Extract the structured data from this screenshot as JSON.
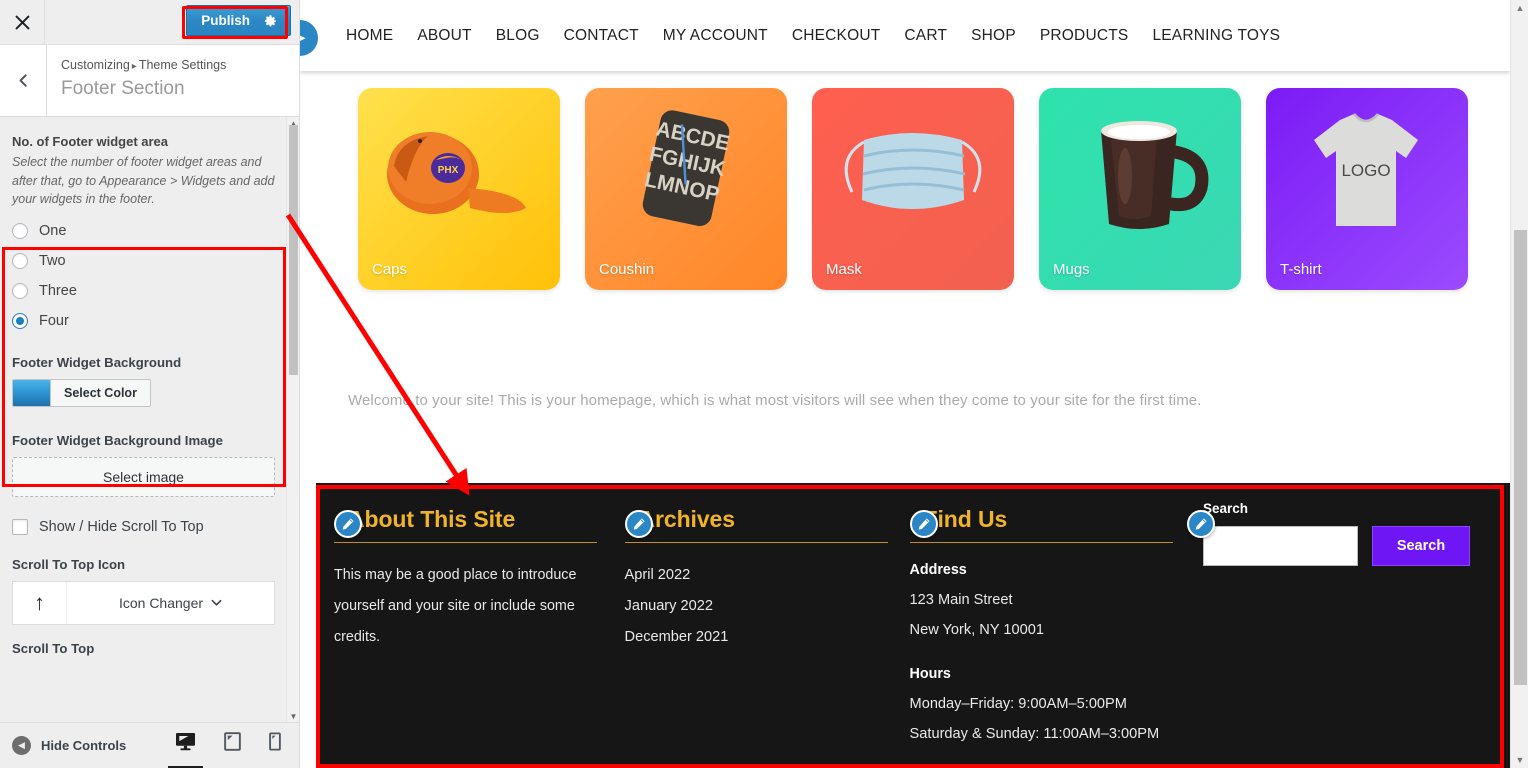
{
  "customizer": {
    "close_icon": "close-icon",
    "publish_label": "Publish",
    "gear_icon": "gear-icon",
    "back_icon": "chevron-left-icon",
    "breadcrumb_root": "Customizing",
    "breadcrumb_sep": "▸",
    "breadcrumb_parent": "Theme Settings",
    "section_title": "Footer Section",
    "controls": {
      "footer_widget_area": {
        "title": "No. of Footer widget area",
        "description": "Select the number of footer widget areas and after that, go to Appearance > Widgets and add your widgets in the footer.",
        "options": [
          {
            "label": "One",
            "checked": false
          },
          {
            "label": "Two",
            "checked": false
          },
          {
            "label": "Three",
            "checked": false
          },
          {
            "label": "Four",
            "checked": true
          }
        ],
        "selected": "Four"
      },
      "footer_widget_background": {
        "title": "Footer Widget Background",
        "button_label": "Select Color",
        "swatch_color": "#2f96d6"
      },
      "footer_widget_background_image": {
        "title": "Footer Widget Background Image",
        "button_label": "Select image"
      },
      "scroll_to_top_toggle": {
        "label": "Show / Hide Scroll To Top",
        "checked": false
      },
      "scroll_to_top_icon": {
        "title": "Scroll To Top Icon",
        "preview_icon": "arrow-up-icon",
        "button_label": "Icon Changer",
        "chevron": "chevron-down-icon"
      },
      "scroll_to_top": {
        "title": "Scroll To Top"
      }
    },
    "footerbar": {
      "hide_controls_label": "Hide Controls",
      "collapse_icon": "chevron-left-circle-icon",
      "devices": [
        {
          "name": "desktop",
          "active": true
        },
        {
          "name": "tablet",
          "active": false
        },
        {
          "name": "mobile",
          "active": false
        }
      ]
    }
  },
  "preview": {
    "nav": [
      "HOME",
      "ABOUT",
      "BLOG",
      "CONTACT",
      "MY ACCOUNT",
      "CHECKOUT",
      "CART",
      "SHOP",
      "PRODUCTS",
      "LEARNING TOYS"
    ],
    "cards": [
      {
        "label": "Caps",
        "bg_from": "#ffd93d",
        "bg_to": "#ffb800"
      },
      {
        "label": "Coushin",
        "bg_from": "#ff9e3d",
        "bg_to": "#ff8a2b"
      },
      {
        "label": "Mask",
        "bg_from": "#ff5b52",
        "bg_to": "#f2604f"
      },
      {
        "label": "Mugs",
        "bg_from": "#2fe0a8",
        "bg_to": "#35d9b2"
      },
      {
        "label": "T-shirt",
        "bg_from": "#7b1bf5",
        "bg_to": "#9b4bff"
      }
    ],
    "welcome_text": "Welcome to your site! This is your homepage, which is what most visitors will see when they come to your site for the first time.",
    "footer": {
      "background": "#161616",
      "accent": "#f0b429",
      "widgets": [
        {
          "title": "About This Site",
          "edit_icon": "pencil-icon",
          "paragraph": "This may be a good place to introduce yourself and your site or include some credits."
        },
        {
          "title": "Archives",
          "edit_icon": "pencil-icon",
          "items": [
            "April 2022",
            "January 2022",
            "December 2021"
          ]
        },
        {
          "title": "Find Us",
          "edit_icon": "pencil-icon",
          "address_heading": "Address",
          "address_lines": [
            "123 Main Street",
            "New York, NY 10001"
          ],
          "hours_heading": "Hours",
          "hours_lines": [
            "Monday–Friday: 9:00AM–5:00PM",
            "Saturday & Sunday: 11:00AM–3:00PM"
          ]
        },
        {
          "title": "Search",
          "edit_icon": "pencil-icon",
          "input_value": "",
          "input_placeholder": "",
          "button_label": "Search",
          "button_color": "#6f16f5"
        }
      ]
    }
  },
  "annotations": {
    "highlight_color": "#ff0000",
    "boxes": [
      "publish-button",
      "footer-widget-area-control",
      "footer-widget-preview"
    ],
    "arrow": "control-to-footer"
  }
}
